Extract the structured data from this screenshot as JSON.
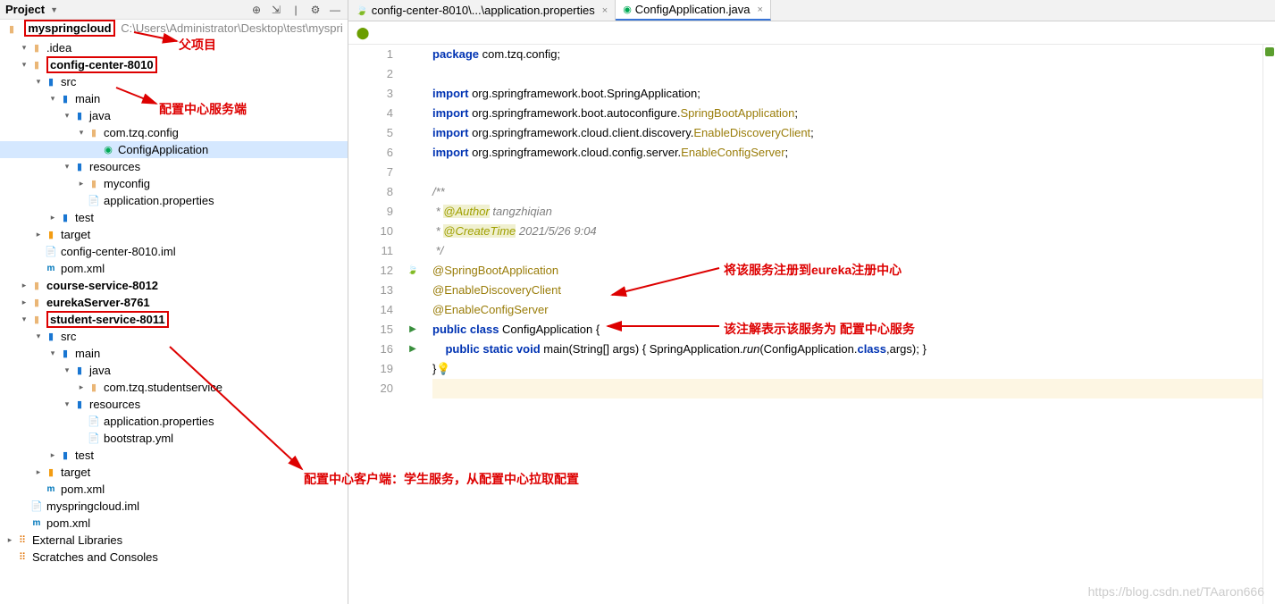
{
  "sidebar": {
    "title": "Project",
    "toolbar_icons": [
      "target",
      "collapse",
      "divider",
      "gear",
      "hide"
    ],
    "breadcrumb_prefix": "myspringcloud",
    "breadcrumb_path": "C:\\Users\\Administrator\\Desktop\\test\\myspri",
    "tree": [
      {
        "i": 1,
        "ar": "d",
        "ic": "folder",
        "lbl": ".idea"
      },
      {
        "i": 1,
        "ar": "d",
        "ic": "folder",
        "lbl": "config-center-8010",
        "bold": true,
        "box": true
      },
      {
        "i": 2,
        "ar": "d",
        "ic": "folder-blue",
        "lbl": "src"
      },
      {
        "i": 3,
        "ar": "d",
        "ic": "folder-blue",
        "lbl": "main"
      },
      {
        "i": 4,
        "ar": "d",
        "ic": "folder-blue",
        "lbl": "java"
      },
      {
        "i": 5,
        "ar": "d",
        "ic": "folder",
        "lbl": "com.tzq.config"
      },
      {
        "i": 6,
        "ar": "",
        "ic": "java",
        "lbl": "ConfigApplication",
        "sel": true
      },
      {
        "i": 4,
        "ar": "d",
        "ic": "folder-blue",
        "lbl": "resources"
      },
      {
        "i": 5,
        "ar": "r",
        "ic": "folder",
        "lbl": "myconfig"
      },
      {
        "i": 5,
        "ar": "",
        "ic": "file",
        "lbl": "application.properties"
      },
      {
        "i": 3,
        "ar": "r",
        "ic": "folder-blue",
        "lbl": "test"
      },
      {
        "i": 2,
        "ar": "r",
        "ic": "folder-tgt",
        "lbl": "target"
      },
      {
        "i": 2,
        "ar": "",
        "ic": "file",
        "lbl": "config-center-8010.iml"
      },
      {
        "i": 2,
        "ar": "",
        "ic": "xml",
        "lbl": "pom.xml"
      },
      {
        "i": 1,
        "ar": "r",
        "ic": "folder",
        "lbl": "course-service-8012",
        "bold": true
      },
      {
        "i": 1,
        "ar": "r",
        "ic": "folder",
        "lbl": "eurekaServer-8761",
        "bold": true
      },
      {
        "i": 1,
        "ar": "d",
        "ic": "folder",
        "lbl": "student-service-8011",
        "bold": true,
        "box": true
      },
      {
        "i": 2,
        "ar": "d",
        "ic": "folder-blue",
        "lbl": "src"
      },
      {
        "i": 3,
        "ar": "d",
        "ic": "folder-blue",
        "lbl": "main"
      },
      {
        "i": 4,
        "ar": "d",
        "ic": "folder-blue",
        "lbl": "java"
      },
      {
        "i": 5,
        "ar": "r",
        "ic": "folder",
        "lbl": "com.tzq.studentservice"
      },
      {
        "i": 4,
        "ar": "d",
        "ic": "folder-blue",
        "lbl": "resources"
      },
      {
        "i": 5,
        "ar": "",
        "ic": "file",
        "lbl": "application.properties"
      },
      {
        "i": 5,
        "ar": "",
        "ic": "file",
        "lbl": "bootstrap.yml"
      },
      {
        "i": 3,
        "ar": "r",
        "ic": "folder-blue",
        "lbl": "test"
      },
      {
        "i": 2,
        "ar": "r",
        "ic": "folder-tgt",
        "lbl": "target"
      },
      {
        "i": 2,
        "ar": "",
        "ic": "xml",
        "lbl": "pom.xml"
      },
      {
        "i": 1,
        "ar": "",
        "ic": "file",
        "lbl": "myspringcloud.iml"
      },
      {
        "i": 1,
        "ar": "",
        "ic": "xml",
        "lbl": "pom.xml"
      },
      {
        "i": 0,
        "ar": "r",
        "ic": "ext",
        "lbl": "External Libraries"
      },
      {
        "i": 0,
        "ar": "",
        "ic": "ext",
        "lbl": "Scratches and Consoles"
      }
    ]
  },
  "tabs": [
    {
      "label": "config-center-8010\\...\\application.properties",
      "icon": "leaf",
      "active": false
    },
    {
      "label": "ConfigApplication.java",
      "icon": "java",
      "active": true
    }
  ],
  "code": {
    "lines": [
      {
        "n": 1,
        "seg": [
          [
            "kw",
            "package "
          ],
          [
            "pkg",
            "com.tzq.config;"
          ]
        ]
      },
      {
        "n": 2,
        "seg": []
      },
      {
        "n": 3,
        "seg": [
          [
            "kw",
            "import "
          ],
          [
            "pkg",
            "org.springframework.boot.SpringApplication;"
          ]
        ]
      },
      {
        "n": 4,
        "seg": [
          [
            "kw",
            "import "
          ],
          [
            "pkg",
            "org.springframework.boot.autoconfigure."
          ],
          [
            "ann",
            "SpringBootApplication"
          ],
          [
            "pkg",
            ";"
          ]
        ]
      },
      {
        "n": 5,
        "seg": [
          [
            "kw",
            "import "
          ],
          [
            "pkg",
            "org.springframework.cloud.client.discovery."
          ],
          [
            "ann",
            "EnableDiscoveryClient"
          ],
          [
            "pkg",
            ";"
          ]
        ]
      },
      {
        "n": 6,
        "seg": [
          [
            "kw",
            "import "
          ],
          [
            "pkg",
            "org.springframework.cloud.config.server."
          ],
          [
            "ann",
            "EnableConfigServer"
          ],
          [
            "pkg",
            ";"
          ]
        ]
      },
      {
        "n": 7,
        "seg": []
      },
      {
        "n": 8,
        "seg": [
          [
            "cmt",
            "/**"
          ]
        ]
      },
      {
        "n": 9,
        "seg": [
          [
            "cmt",
            " * "
          ],
          [
            "ann2",
            "@Author"
          ],
          [
            "cmt",
            " tangzhiqian"
          ]
        ]
      },
      {
        "n": 10,
        "seg": [
          [
            "cmt",
            " * "
          ],
          [
            "ann2",
            "@CreateTime"
          ],
          [
            "cmt",
            " 2021/5/26 9:04"
          ]
        ]
      },
      {
        "n": 11,
        "seg": [
          [
            "cmt",
            " */"
          ]
        ]
      },
      {
        "n": 12,
        "seg": [
          [
            "ann",
            "@SpringBootApplication"
          ]
        ],
        "gut": "leaf"
      },
      {
        "n": 13,
        "seg": [
          [
            "ann",
            "@EnableDiscoveryClient"
          ]
        ]
      },
      {
        "n": 14,
        "seg": [
          [
            "ann",
            "@EnableConfigServer"
          ]
        ]
      },
      {
        "n": 15,
        "seg": [
          [
            "kw",
            "public class "
          ],
          [
            "cls",
            "ConfigApplication "
          ],
          [
            "pkg",
            "{"
          ]
        ],
        "gut": "run"
      },
      {
        "n": 16,
        "seg": [
          [
            "pkg",
            "    "
          ],
          [
            "kw",
            "public static void "
          ],
          [
            "cls",
            "main"
          ],
          [
            "pkg",
            "(String[] args) { SpringApplication."
          ],
          [
            "mth",
            "run"
          ],
          [
            "pkg",
            "(ConfigApplication."
          ],
          [
            "kw",
            "class"
          ],
          [
            "pkg",
            ",args); }"
          ]
        ],
        "gut": "run2"
      },
      {
        "n": 19,
        "seg": [
          [
            "pkg",
            "}"
          ],
          [
            "bulb",
            "💡"
          ]
        ]
      },
      {
        "n": 20,
        "seg": [],
        "hl": true
      }
    ]
  },
  "annotations": {
    "a1": "父项目",
    "a2": "配置中心服务端",
    "a3": "将该服务注册到eureka注册中心",
    "a4": "该注解表示该服务为 配置中心服务",
    "a5": "配置中心客户端：学生服务，从配置中心拉取配置"
  },
  "watermark": "https://blog.csdn.net/TAaron666"
}
